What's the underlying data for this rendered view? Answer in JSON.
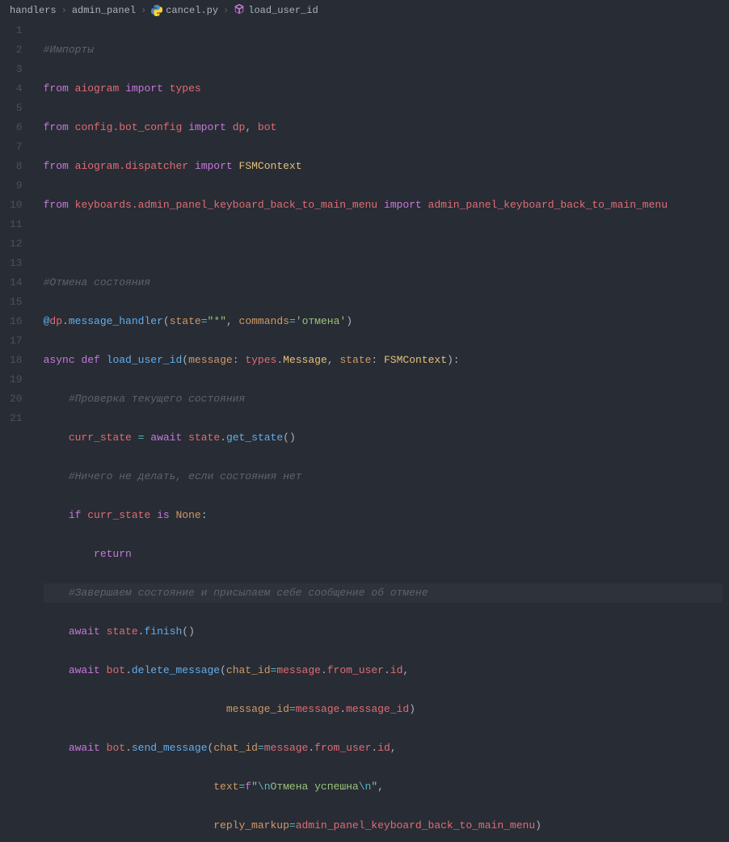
{
  "breadcrumb": {
    "seg1": "handlers",
    "seg2": "admin_panel",
    "seg3": "cancel.py",
    "seg4": "load_user_id",
    "sep": "›"
  },
  "gutter": [
    "1",
    "2",
    "3",
    "4",
    "5",
    "6",
    "7",
    "8",
    "9",
    "10",
    "11",
    "12",
    "13",
    "14",
    "15",
    "16",
    "17",
    "18",
    "19",
    "20",
    "21"
  ],
  "t": {
    "from": "from",
    "import": "import",
    "async": "async",
    "def": "def",
    "await": "await",
    "if": "if",
    "is": "is",
    "return": "return",
    "None": "None",
    "aiogram": "aiogram",
    "types": "types",
    "config_bot_config": "config.bot_config",
    "dp": "dp",
    "bot": "bot",
    "aiogram_dispatcher": "aiogram.dispatcher",
    "FSMContext": "FSMContext",
    "kb_module": "keyboards.admin_panel_keyboard_back_to_main_menu",
    "kb_name": "admin_panel_keyboard_back_to_main_menu",
    "cmt1": "#Импорты",
    "cmt2": "#Отмена состояния",
    "cmt3": "#Проверка текущего состояния",
    "cmt4": "#Ничего не делать, если состояния нет",
    "cmt5": "#Завершаем состояние и присылаем себе сообщение об отмене",
    "message_handler": "message_handler",
    "state_kw": "state",
    "star": "\"*\"",
    "commands": "commands",
    "otmena": "'отмена'",
    "load_user_id": "load_user_id",
    "message": "message",
    "Message": "Message",
    "state_param": "state",
    "curr_state": "curr_state",
    "get_state": "get_state",
    "finish": "finish",
    "delete_message": "delete_message",
    "send_message": "send_message",
    "chat_id": "chat_id",
    "from_user": "from_user",
    "id": "id",
    "message_id": "message_id",
    "text_kw": "text",
    "reply_markup": "reply_markup",
    "fprefix": "f",
    "fstr_open": "\"",
    "fesc1": "\\n",
    "fstr_mid": "Отмена успешна",
    "fesc2": "\\n",
    "fstr_close": "\""
  }
}
